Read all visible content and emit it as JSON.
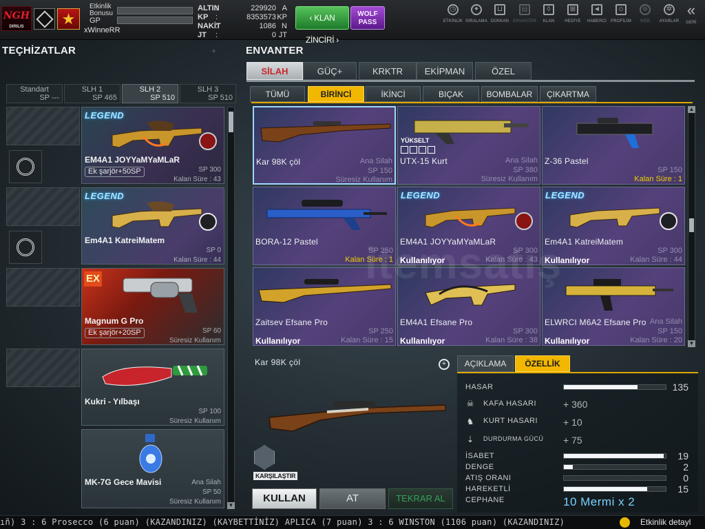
{
  "player": {
    "clan_logo_text": "NGH",
    "clan_logo_sub": "DIRILIS",
    "labels": [
      "Etkinlik Bonusu",
      "GP"
    ],
    "username": "xWinneRR"
  },
  "currency": [
    {
      "key": "ALTIN",
      "value": "229920",
      "unit": "A"
    },
    {
      "key": "KP",
      "value": "8353573",
      "unit": "KP"
    },
    {
      "key": "NAKİT",
      "value": "1086",
      "unit": "N"
    },
    {
      "key": "JT",
      "value": "0",
      "unit": "JT"
    }
  ],
  "buttons": {
    "klan_zinciri": "KLAN ZİNCİRİ",
    "wolf_pass_1": "WOLF",
    "wolf_pass_2": "PASS"
  },
  "nav": [
    {
      "label": "ETKİNLİK",
      "icon": "clock-icon"
    },
    {
      "label": "SIRALAMA",
      "icon": "medal-icon"
    },
    {
      "label": "DÜKKAN",
      "icon": "cart-icon"
    },
    {
      "label": "ENVANTER",
      "icon": "inventory-icon"
    },
    {
      "label": "KLAN",
      "icon": "shield-icon"
    },
    {
      "label": "HEDİYE",
      "icon": "gift-icon"
    },
    {
      "label": "HABERCİ",
      "icon": "megaphone-icon"
    },
    {
      "label": "PROFİLİM",
      "icon": "profile-icon"
    },
    {
      "label": "WEB",
      "icon": "globe-icon"
    },
    {
      "label": "AYARLAR",
      "icon": "gear-icon"
    },
    {
      "label": "GERİ",
      "icon": "back-icon"
    }
  ],
  "equipment": {
    "title": "TEÇHİZATLAR",
    "slot_tabs": [
      {
        "name": "Standart",
        "sp": "SP ---"
      },
      {
        "name": "SLH 1",
        "sp": "SP 465"
      },
      {
        "name": "SLH 2",
        "sp": "SP 510"
      },
      {
        "name": "SLH 3",
        "sp": "SP 510"
      }
    ],
    "items": [
      {
        "badge": "LEGEND",
        "name": "EM4A1 JOYYaMYaMLaR",
        "extra": "Ek şarjör+50SP",
        "sp": "SP 300",
        "time": "Kalan Süre : 43"
      },
      {
        "badge": "LEGEND",
        "name": "Em4A1 KatreiMatem",
        "sp": "SP 0",
        "time": "Kalan Süre : 44"
      },
      {
        "badge": "EX",
        "name": "Magnum G Pro",
        "extra": "Ek şarjör+20SP",
        "sp": "SP 60",
        "time": "Süresiz Kullanım"
      },
      {
        "name": "Kukri - Yılbaşı",
        "sp": "SP 100",
        "time": "Süresiz Kullanım"
      },
      {
        "name": "MK-7G Gece Mavisi",
        "type": "Ana Silah",
        "sp": "SP 50",
        "time": "Süresiz Kullanım"
      }
    ]
  },
  "inventory": {
    "title": "ENVANTER",
    "categories": [
      "SİLAH",
      "GÜÇ+",
      "KRKTR",
      "EKİPMAN",
      "ÖZEL"
    ],
    "subcategories": [
      "TÜMÜ",
      "BİRİNCİ",
      "İKİNCİ",
      "BIÇAK",
      "BOMBALAR",
      "ÇIKARTMA"
    ],
    "items": [
      {
        "name": "Kar 98K çöl",
        "type": "Ana Silah",
        "sp": "SP 150",
        "status": "",
        "expiry": "Süresiz Kullanım"
      },
      {
        "name": "UTX-15 Kurt",
        "type": "Ana Silah",
        "sp": "SP 380",
        "status": "",
        "expiry": "Süresiz Kullanım",
        "upgrade": "YÜKSELT"
      },
      {
        "name": "Z-36 Pastel",
        "type": "",
        "sp": "SP 150",
        "status": "",
        "expiry": "Kalan Süre : 1"
      },
      {
        "name": "BORA-12 Pastel",
        "type": "",
        "sp": "SP 250",
        "status": "",
        "expiry": "Kalan Süre : 1"
      },
      {
        "name": "EM4A1 JOYYaMYaMLaR",
        "type": "",
        "sp": "SP 300",
        "status": "Kullanılıyor",
        "expiry": "Kalan Süre : 43",
        "badge": "LEGEND"
      },
      {
        "name": "Em4A1 KatreiMatem",
        "type": "",
        "sp": "SP 300",
        "status": "Kullanılıyor",
        "expiry": "Kalan Süre : 44",
        "badge": "LEGEND"
      },
      {
        "name": "Zaitsev Efsane Pro",
        "type": "",
        "sp": "SP 250",
        "status": "Kullanılıyor",
        "expiry": "Kalan Süre : 15"
      },
      {
        "name": "EM4A1 Efsane Pro",
        "type": "",
        "sp": "SP 300",
        "status": "Kullanılıyor",
        "expiry": "Kalan Süre : 38"
      },
      {
        "name": "ELWRCI M6A2 Efsane Pro",
        "type": "Ana Silah",
        "sp": "SP 150",
        "status": "Kullanılıyor",
        "expiry": "Kalan Süre : 20"
      }
    ]
  },
  "detail": {
    "name": "Kar 98K çöl",
    "compare": "KARŞILAŞTIR",
    "actions": {
      "use": "KULLAN",
      "drop": "AT",
      "rebuy": "TEKRAR AL"
    },
    "tabs": [
      "AÇIKLAMA",
      "ÖZELLİK"
    ],
    "stats": [
      {
        "label": "HASAR",
        "value": "135",
        "fill": 0.72
      },
      {
        "label": "KAFA HASARI",
        "bonus": "+ 360",
        "icon": "skull-icon"
      },
      {
        "label": "KURT HASARI",
        "bonus": "+ 10",
        "icon": "wolf-icon"
      },
      {
        "label": "DURDURMA GÜCÜ",
        "bonus": "+ 75",
        "icon": "stopping-power-icon"
      },
      {
        "label": "İSABET",
        "value": "19",
        "fill": 0.98
      },
      {
        "label": "DENGE",
        "value": "2",
        "fill": 0.09
      },
      {
        "label": "ATIŞ ORANI",
        "value": "0",
        "fill": 0.0
      },
      {
        "label": "HAREKETLİ",
        "value": "15",
        "fill": 0.82
      },
      {
        "label": "CEPHANE",
        "ammo": "10 Mermi x 2"
      }
    ]
  },
  "ticker": {
    "text": "ıñ) 3 : 6 Prosecco (6 puan) (KAZANDINIZ)        (KAYBETTİNİZ) APLICA (7 puan) 3 : 6 WINSTON (1106 puan) (KAZANDINIZ)",
    "right": "Etkinlik detayl"
  },
  "colors": {
    "accent": "#f2b700",
    "tab_active_text": "#c9282b",
    "klan": "#3ea84a",
    "wolf": "#8a33bd"
  }
}
